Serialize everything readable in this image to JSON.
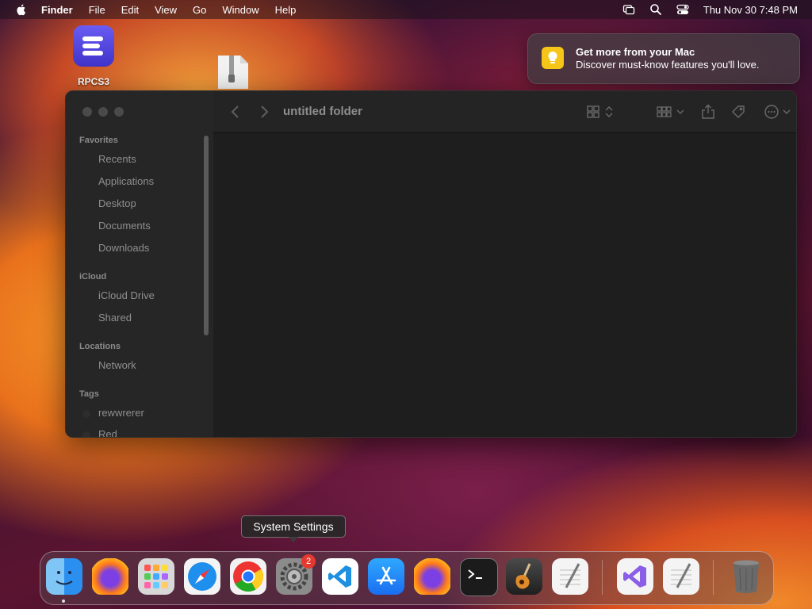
{
  "menubar": {
    "items": [
      "Finder",
      "File",
      "Edit",
      "View",
      "Go",
      "Window",
      "Help"
    ],
    "datetime": "Thu Nov 30  7:48 PM"
  },
  "desktop": {
    "rpcs3_label": "RPCS3"
  },
  "notification": {
    "title": "Get more from your Mac",
    "body": "Discover must-know features you'll love."
  },
  "finder": {
    "title": "untitled folder",
    "sections": {
      "favorites": "Favorites",
      "icloud": "iCloud",
      "locations": "Locations",
      "tags": "Tags"
    },
    "favorites": [
      "Recents",
      "Applications",
      "Desktop",
      "Documents",
      "Downloads"
    ],
    "icloud": [
      "iCloud Drive",
      "Shared"
    ],
    "locations": [
      "Network"
    ],
    "tags": [
      "rewwrerer",
      "Red"
    ]
  },
  "tooltip": "System Settings",
  "dock": {
    "settings_badge": "2",
    "apps": [
      "finder-icon",
      "firefox-icon",
      "launchpad-icon",
      "safari-icon",
      "chrome-icon",
      "system-settings-icon",
      "vscode-icon",
      "app-store-icon",
      "firefox-icon",
      "terminal-icon",
      "garageband-icon",
      "textedit-icon",
      "visual-studio-icon",
      "textedit-icon",
      "trash-icon"
    ]
  }
}
